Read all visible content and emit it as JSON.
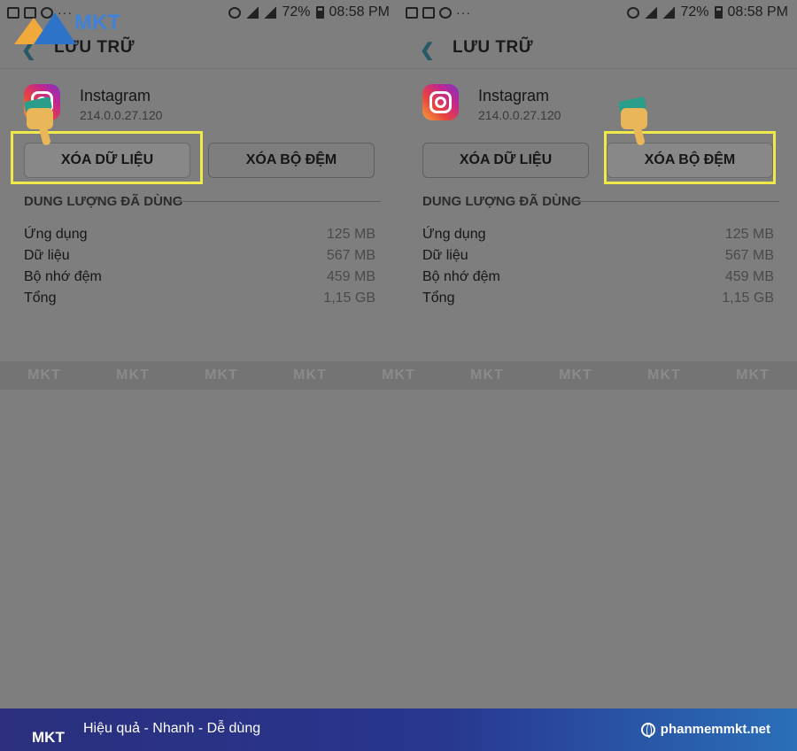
{
  "status": {
    "battery": "72%",
    "time": "08:58 PM",
    "more": "···"
  },
  "toolbar": {
    "title": "LƯU TRỮ"
  },
  "app": {
    "name": "Instagram",
    "version": "214.0.0.27.120"
  },
  "buttons": {
    "clear_data": "XÓA DỮ LIỆU",
    "clear_cache": "XÓA BỘ ĐỆM"
  },
  "usage": {
    "title": "DUNG LƯỢNG ĐÃ DÙNG",
    "rows": [
      {
        "label": "Ứng dụng",
        "value": "125 MB"
      },
      {
        "label": "Dữ liệu",
        "value": "567 MB"
      },
      {
        "label": "Bộ nhớ đệm",
        "value": "459 MB"
      },
      {
        "label": "Tổng",
        "value": "1,15 GB"
      }
    ]
  },
  "watermark": {
    "text": "MKT"
  },
  "logo": {
    "text": "MKT"
  },
  "footer": {
    "logo": "MKT",
    "slogan": "Hiệu quả - Nhanh - Dễ dùng",
    "site": "phanmemmkt.net"
  },
  "colors": {
    "highlight": "#f1e84a",
    "accent": "#2d74c9",
    "footer": "#28368e"
  },
  "icons": [
    "back-arrow-icon",
    "instagram-icon",
    "pointing-hand-icon",
    "globe-icon"
  ]
}
